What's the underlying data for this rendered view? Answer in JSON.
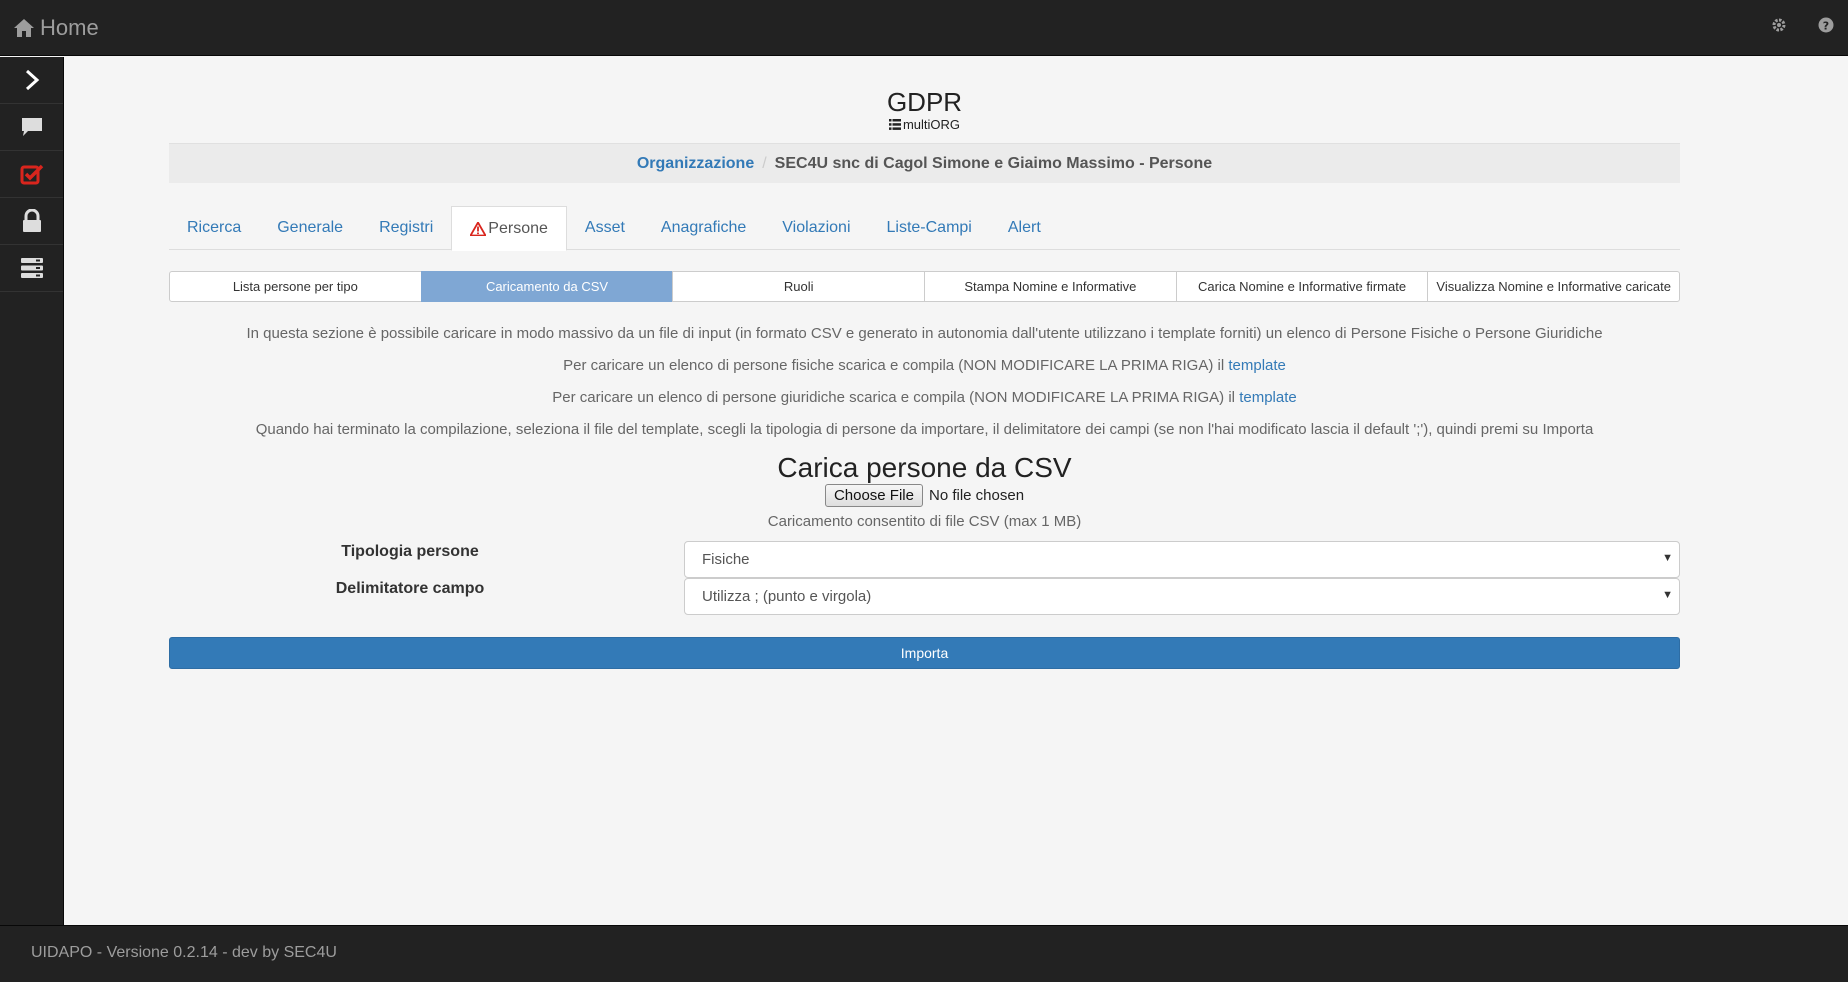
{
  "topbar": {
    "home_label": "Home",
    "icons": [
      "home-icon",
      "gear-icon",
      "help-icon"
    ]
  },
  "sidebar": {
    "items": [
      "chevron-right-icon",
      "comment-icon",
      "checkbox-icon",
      "lock-icon",
      "server-icon"
    ]
  },
  "header": {
    "title": "GDPR",
    "subtitle": "multiORG"
  },
  "breadcrumb": {
    "link": "Organizzazione",
    "current": "SEC4U snc di Cagol Simone e Giaimo Massimo - Persone"
  },
  "tabs": [
    {
      "label": "Ricerca"
    },
    {
      "label": "Generale"
    },
    {
      "label": "Registri"
    },
    {
      "label": "Persone",
      "active": true
    },
    {
      "label": "Asset"
    },
    {
      "label": "Anagrafiche"
    },
    {
      "label": "Violazioni"
    },
    {
      "label": "Liste-Campi"
    },
    {
      "label": "Alert"
    }
  ],
  "subtabs": [
    {
      "label": "Lista persone per tipo"
    },
    {
      "label": "Caricamento da CSV",
      "active": true
    },
    {
      "label": "Ruoli"
    },
    {
      "label": "Stampa Nomine e Informative"
    },
    {
      "label": "Carica Nomine e Informative firmate"
    },
    {
      "label": "Visualizza Nomine e Informative caricate"
    }
  ],
  "info": {
    "line1": "In questa sezione è possibile caricare in modo massivo da un file di input (in formato CSV e generato in autonomia dall'utente utilizzano i template forniti) un elenco di Persone Fisiche o Persone Giuridiche",
    "line2": "Per caricare un elenco di persone fisiche scarica e compila (NON MODIFICARE LA PRIMA RIGA) il ",
    "line2_link": "template",
    "line3": "Per caricare un elenco di persone giuridiche scarica e compila (NON MODIFICARE LA PRIMA RIGA) il ",
    "line3_link": "template",
    "line4": "Quando hai terminato la compilazione, seleziona il file del template, scegli la tipologia di persone da importare, il delimitatore dei campi (se non l'hai modificato lascia il default ';'), quindi premi su Importa"
  },
  "upload": {
    "title": "Carica persone da CSV",
    "choose_file": "Choose File",
    "no_file": "No file chosen",
    "help": "Caricamento consentito di file CSV (max 1 MB)"
  },
  "form": {
    "tipologia_label": "Tipologia persone",
    "tipologia_value": "Fisiche",
    "delimitatore_label": "Delimitatore campo",
    "delimitatore_value": "Utilizza ; (punto e virgola)"
  },
  "import_button": "Importa",
  "footer": {
    "text": "UIDAPO - Versione 0.2.14 - dev by SEC4U"
  },
  "colors": {
    "link": "#337ab7",
    "primary": "#337ab7",
    "active_subtab": "#7fa7d4",
    "warning": "#d9251d",
    "dark": "#222222"
  }
}
